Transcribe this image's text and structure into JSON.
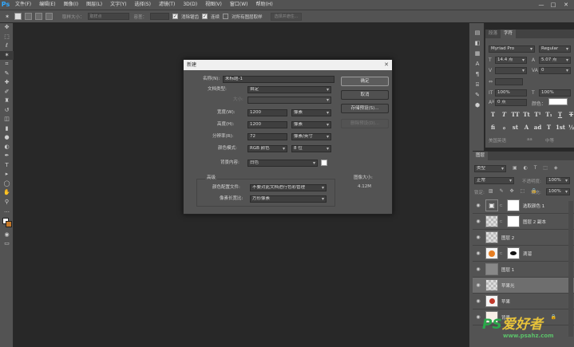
{
  "menubar": {
    "logo": "Ps",
    "items": [
      "文件(F)",
      "编辑(E)",
      "图像(I)",
      "图层(L)",
      "文字(Y)",
      "选择(S)",
      "滤镜(T)",
      "3D(D)",
      "视图(V)",
      "窗口(W)",
      "帮助(H)"
    ],
    "minimize": "—",
    "maximize": "□",
    "close": "✕"
  },
  "options": {
    "sample_size_label": "取样大小：",
    "sample_size_value": "取样点",
    "tolerance_label": "容差：",
    "antialias_label": "消除锯齿",
    "contiguous_label": "连续",
    "sample_all_label": "对所有图层取样",
    "select_subject": "选择并遮住..."
  },
  "dialog": {
    "title": "新建",
    "close": "✕",
    "name_label": "名称(N):",
    "name_value": "未标题-1",
    "preset_label": "文档类型:",
    "preset_value": "自定",
    "size_label": "大小:",
    "width_label": "宽度(W):",
    "width_value": "1200",
    "width_unit": "像素",
    "height_label": "高度(H):",
    "height_value": "1200",
    "height_unit": "像素",
    "resolution_label": "分辨率(R):",
    "resolution_value": "72",
    "resolution_unit": "像素/英寸",
    "colormode_label": "颜色模式:",
    "colormode_value": "RGB 颜色",
    "bitdepth_value": "8 位",
    "bg_label": "背景内容:",
    "bg_value": "白色",
    "advanced_label": "高级",
    "profile_label": "颜色配置文件:",
    "profile_value": "不要对此文档进行色彩管理",
    "aspect_label": "像素长宽比:",
    "aspect_value": "方形像素",
    "ok": "确定",
    "cancel": "取消",
    "save_preset": "存储预设(S)...",
    "delete_preset": "删除预设(D)...",
    "image_size_label": "图像大小:",
    "image_size_value": "4.12M",
    "bg_swatch_color": "#ffffff"
  },
  "charpanel": {
    "tabs": [
      "段落",
      "字符"
    ],
    "font_family": "Myriad Pro",
    "font_style": "Regular",
    "font_size": "14.4 点",
    "leading": "5.07 点",
    "tracking": "0",
    "vscale": "100%",
    "hscale": "100%",
    "baseline": "0 点",
    "color_label": "颜色：",
    "lang_1": "美国英语",
    "lang_2": "aa",
    "lang_3": "中等",
    "tt_buttons": [
      "T",
      "T",
      "TT",
      "Tt",
      "T¹",
      "T₁",
      "T",
      "T"
    ],
    "ot_buttons": [
      "fi",
      "ℴ",
      "st",
      "A",
      "ad",
      "T",
      "1st",
      "½"
    ]
  },
  "layers": {
    "tab": "图层",
    "filter_value": "类型",
    "blend_value": "正常",
    "opacity_label": "不透明度:",
    "opacity_value": "100%",
    "lock_label": "锁定:",
    "fill_label": "填充:",
    "fill_value": "100%",
    "items": [
      {
        "name": "选取颜色 1"
      },
      {
        "name": "图层 2 副本"
      },
      {
        "name": "图层 2"
      },
      {
        "name": "滴溜"
      },
      {
        "name": "图层 1"
      },
      {
        "name": "苹果光"
      },
      {
        "name": "苹果"
      },
      {
        "name": "背景"
      }
    ]
  },
  "watermark": {
    "ps": "PS",
    "cn": "爱好者",
    "url": "www.psahz.com"
  }
}
